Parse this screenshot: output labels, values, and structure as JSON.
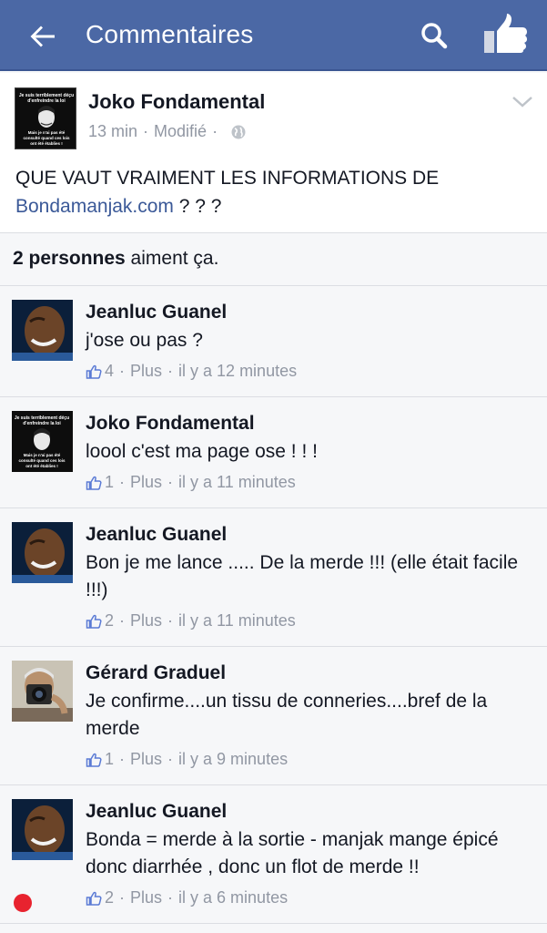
{
  "header": {
    "title": "Commentaires",
    "background": "#4b68a5"
  },
  "post": {
    "author": "Joko Fondamental",
    "time": "13 min",
    "edited": "Modifié",
    "dot": "·",
    "text_before": "QUE VAUT VRAIMENT LES INFORMATIONS DE",
    "link": "Bondamanjak.com",
    "text_after": " ? ? ?",
    "avatar_caption_1": "Je suis terriblement déçu",
    "avatar_caption_2": "d'enfreindre la loi",
    "avatar_caption_3": "Mais je n'ai pas été",
    "avatar_caption_4": "consulté quand ces lois",
    "avatar_caption_5": "ont été établies !"
  },
  "likes": {
    "count": "2 personnes",
    "suffix": " aiment ça."
  },
  "comments": [
    {
      "author": "Jeanluc Guanel",
      "text": "j'ose ou pas ?",
      "likes": "4",
      "more": "Plus",
      "time": "il y a 12 minutes"
    },
    {
      "author": "Joko Fondamental",
      "text": "loool c'est ma page ose ! ! !",
      "likes": "1",
      "more": "Plus",
      "time": "il y a 11 minutes"
    },
    {
      "author": "Jeanluc Guanel",
      "text": "Bon je me lance ..... De la merde !!! (elle était facile !!!)",
      "likes": "2",
      "more": "Plus",
      "time": "il y a 11 minutes"
    },
    {
      "author": "Gérard Graduel",
      "text": "Je confirme....un tissu de conneries....bref de la merde",
      "likes": "1",
      "more": "Plus",
      "time": "il y a 9 minutes"
    },
    {
      "author": "Jeanluc Guanel",
      "text": "Bonda = merde à la sortie - manjak mange épicé donc diarrhée , donc un flot de merde !!",
      "likes": "2",
      "more": "Plus",
      "time": "il y a 6 minutes"
    }
  ],
  "colors": {
    "link": "#3b5998",
    "meta": "#9197a3",
    "notification_dot": "#e8232f"
  }
}
